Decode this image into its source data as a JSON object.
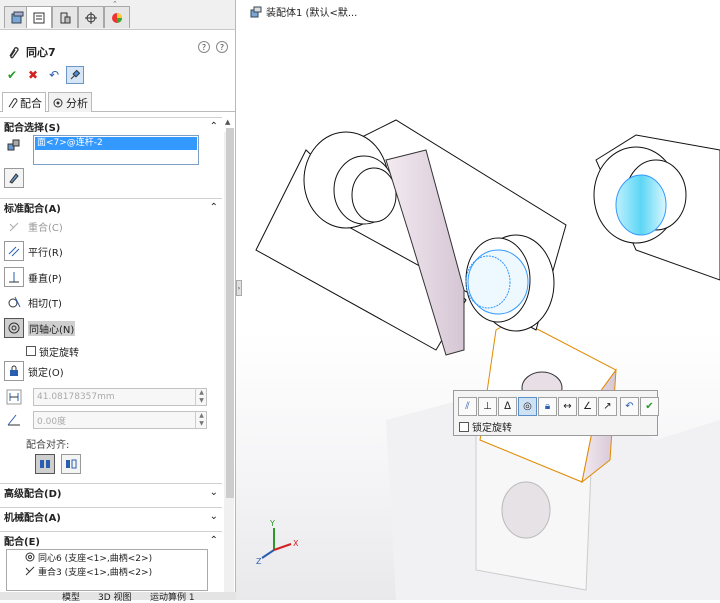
{
  "feature_manager": {
    "tabs": [
      "featuremanager-tree-icon",
      "propertymanager-icon",
      "configuration-manager-icon",
      "dimxpert-icon",
      "display-manager-icon"
    ]
  },
  "property_manager": {
    "title": "同心7",
    "ok_icon": "checkmark-icon",
    "cancel_icon": "close-icon",
    "undo_icon": "undo-icon",
    "pin_icon": "pushpin-icon",
    "tabs": [
      {
        "label": "配合",
        "icon": "paperclip-icon"
      },
      {
        "label": "分析",
        "icon": "analysis-icon"
      }
    ],
    "mate_selection": {
      "header": "配合选择(S)",
      "selected_item": "面<7>@连杆-2"
    },
    "standard_mates": {
      "header": "标准配合(A)",
      "items": [
        {
          "label": "重合(C)",
          "icon": "coincident-icon",
          "enabled": false
        },
        {
          "label": "平行(R)",
          "icon": "parallel-icon",
          "enabled": true
        },
        {
          "label": "垂直(P)",
          "icon": "perpendicular-icon",
          "enabled": true
        },
        {
          "label": "相切(T)",
          "icon": "tangent-icon",
          "enabled": true
        },
        {
          "label": "同轴心(N)",
          "icon": "concentric-icon",
          "enabled": true,
          "selected": true
        }
      ],
      "lock_rotation_label": "锁定旋转",
      "lock_label": "锁定(O)",
      "distance_value": "41.08178357mm",
      "angle_value": "0.00度",
      "alignment_label": "配合对齐:"
    },
    "advanced_mates": {
      "header": "高级配合(D)"
    },
    "mechanical_mates": {
      "header": "机械配合(A)"
    },
    "mates": {
      "header": "配合(E)",
      "items": [
        {
          "label": "同心6 (支座<1>,曲柄<2>)",
          "icon": "concentric-icon"
        },
        {
          "label": "重合3 (支座<1>,曲柄<2>)",
          "icon": "coincident-icon"
        }
      ]
    }
  },
  "bottom_tabs": [
    "模型",
    "3D 视图",
    "运动算例 1"
  ],
  "viewport": {
    "tree_title": "装配体1 (默认<默...",
    "popup": {
      "lock_rotation_label": "锁定旋转"
    }
  },
  "colors": {
    "selection_blue": "#3399ff",
    "highlight_orange": "#e08a00",
    "face_cyan": "#8fe3f5"
  }
}
